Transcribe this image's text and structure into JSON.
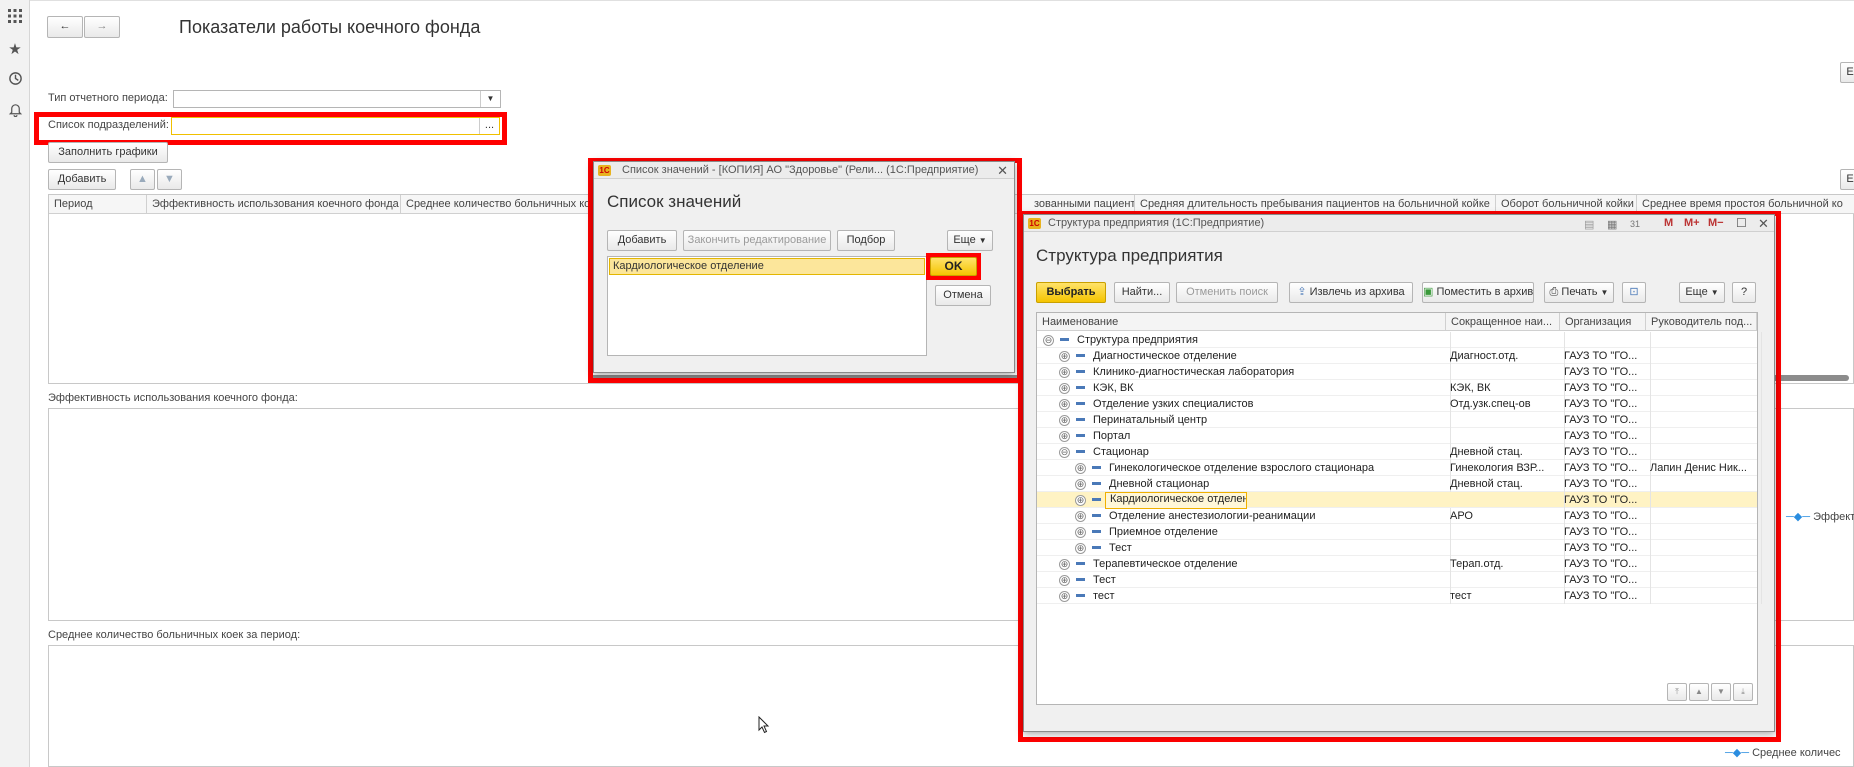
{
  "page": {
    "title": "Показатели работы коечного фонда",
    "period_type_label": "Тип отчетного периода:",
    "period_type_value": "",
    "units_label": "Список подразделений:",
    "units_value": "",
    "units_choose_label": "...",
    "fill_charts_label": "Заполнить графики",
    "add_label": "Добавить",
    "more_right_label": "Е",
    "grid_columns": [
      "Период",
      "Эффективность использования коечного фонда",
      "Среднее количество больничных ко",
      "зованными пациентами",
      "Средняя длительность пребывания пациентов на больничной койке",
      "Оборот больничной койки",
      "Среднее время простоя больничной ко"
    ],
    "chart1_label": "Эффективность использования коечного фонда:",
    "chart1_legend": "Эффекти",
    "chart2_label": "Среднее количество больничных коек за период:",
    "chart2_legend": "Среднее количес"
  },
  "nav": {
    "back": "←",
    "forward": "→"
  },
  "values_dialog": {
    "window_title": "Список значений - [КОПИЯ] АО \"Здоровье\" (Рели... (1С:Предприятие)",
    "heading": "Список значений",
    "add_label": "Добавить",
    "finish_label": "Закончить редактирование",
    "pick_label": "Подбор",
    "more_label": "Еще",
    "items": [
      "Кардиологическое отделение"
    ],
    "ok_label": "OK",
    "cancel_label": "Отмена"
  },
  "structure_dialog": {
    "window_title": "Структура предприятия (1С:Предприятие)",
    "title_buttons": [
      "M",
      "M+",
      "M−"
    ],
    "heading": "Структура предприятия",
    "select_label": "Выбрать",
    "find_label": "Найти...",
    "cancel_search_label": "Отменить поиск",
    "unarchive_label": "Извлечь из архива",
    "archive_label": "Поместить в архив",
    "print_label": "Печать",
    "more_label": "Еще",
    "help_label": "?",
    "columns": [
      "Наименование",
      "Сокращенное наи...",
      "Организация",
      "Руководитель под..."
    ],
    "rows": [
      {
        "level": 0,
        "name": "Структура предприятия",
        "short": "",
        "org": "",
        "head": "",
        "toggle": "⊖"
      },
      {
        "level": 1,
        "name": "Диагностическое отделение",
        "short": "Диагност.отд.",
        "org": "ГАУЗ ТО \"ГО...",
        "head": "",
        "toggle": "⊕"
      },
      {
        "level": 1,
        "name": "Клинико-диагностическая лаборатория",
        "short": "",
        "org": "ГАУЗ ТО \"ГО...",
        "head": "",
        "toggle": "⊕"
      },
      {
        "level": 1,
        "name": "КЭК, ВК",
        "short": "КЭК, ВК",
        "org": "ГАУЗ ТО \"ГО...",
        "head": "",
        "toggle": "⊕"
      },
      {
        "level": 1,
        "name": "Отделение узких специалистов",
        "short": "Отд.узк.спец-ов",
        "org": "ГАУЗ ТО \"ГО...",
        "head": "",
        "toggle": "⊕"
      },
      {
        "level": 1,
        "name": "Перинатальный центр",
        "short": "",
        "org": "ГАУЗ ТО \"ГО...",
        "head": "",
        "toggle": "⊕"
      },
      {
        "level": 1,
        "name": "Портал",
        "short": "",
        "org": "ГАУЗ ТО \"ГО...",
        "head": "",
        "toggle": "⊕"
      },
      {
        "level": 1,
        "name": "Стационар",
        "short": "Дневной стац.",
        "org": "ГАУЗ ТО \"ГО...",
        "head": "",
        "toggle": "⊖"
      },
      {
        "level": 2,
        "name": "Гинекологическое отделение взрослого стационара",
        "short": "Гинекология ВЗР...",
        "org": "ГАУЗ ТО \"ГО...",
        "head": "Лапин Денис Ник...",
        "toggle": "⊕"
      },
      {
        "level": 2,
        "name": "Дневной стационар",
        "short": "Дневной стац.",
        "org": "ГАУЗ ТО \"ГО...",
        "head": "",
        "toggle": "⊕"
      },
      {
        "level": 2,
        "name": "Кардиологическое отделение",
        "short": "",
        "org": "ГАУЗ ТО \"ГО...",
        "head": "",
        "toggle": "⊕",
        "selected": true
      },
      {
        "level": 2,
        "name": "Отделение анестезиологии-реанимации",
        "short": "АРО",
        "org": "ГАУЗ ТО \"ГО...",
        "head": "",
        "toggle": "⊕"
      },
      {
        "level": 2,
        "name": "Приемное отделение",
        "short": "",
        "org": "ГАУЗ ТО \"ГО...",
        "head": "",
        "toggle": "⊕"
      },
      {
        "level": 2,
        "name": "Тест",
        "short": "",
        "org": "ГАУЗ ТО \"ГО...",
        "head": "",
        "toggle": "⊕"
      },
      {
        "level": 1,
        "name": "Терапевтическое отделение",
        "short": "Терап.отд.",
        "org": "ГАУЗ ТО \"ГО...",
        "head": "",
        "toggle": "⊕"
      },
      {
        "level": 1,
        "name": "Тест",
        "short": "",
        "org": "ГАУЗ ТО \"ГО...",
        "head": "",
        "toggle": "⊕"
      },
      {
        "level": 1,
        "name": "тест",
        "short": "тест",
        "org": "ГАУЗ ТО \"ГО...",
        "head": "",
        "toggle": "⊕"
      }
    ]
  },
  "colors": {
    "highlight_red": "#ff0000",
    "accent_yellow": "#f5c400",
    "selection": "#fff3c4"
  },
  "icons": [
    "apps-grid-icon",
    "star-icon",
    "history-icon",
    "bell-icon",
    "cursor-icon"
  ]
}
